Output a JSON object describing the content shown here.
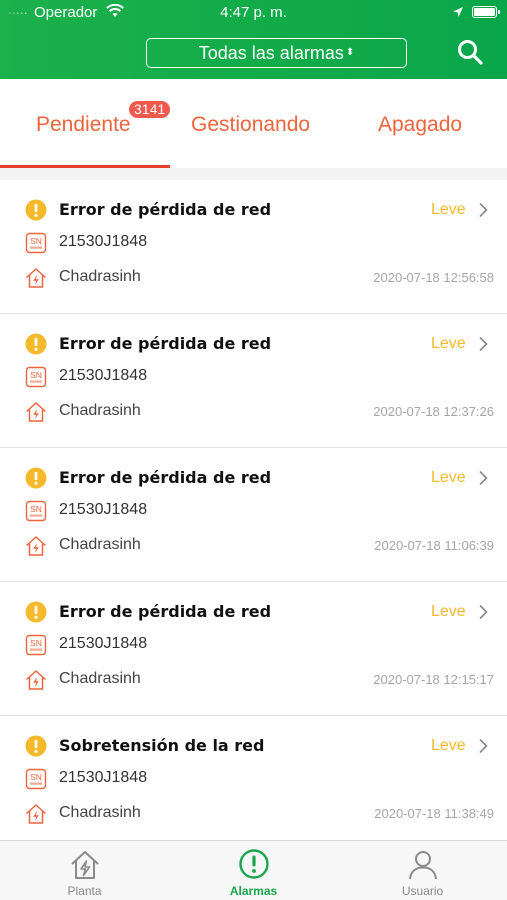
{
  "status_bar": {
    "signal": ".....",
    "carrier": "Operador",
    "time": "4:47 p. m."
  },
  "header": {
    "filter_label": "Todas las alarmas",
    "filter_arrows": "⬍",
    "search_icon": "search-icon"
  },
  "tabs": {
    "items": [
      {
        "label": "Pendiente",
        "badge": "3141",
        "active": true
      },
      {
        "label": "Gestionando",
        "active": false
      },
      {
        "label": "Apagado",
        "active": false
      }
    ]
  },
  "alarms": [
    {
      "title": "Error de pérdida de red",
      "level": "Leve",
      "sn": "21530J1848",
      "plant": "Chadrasinh",
      "time": "2020-07-18 12:56:58"
    },
    {
      "title": "Error de pérdida de red",
      "level": "Leve",
      "sn": "21530J1848",
      "plant": "Chadrasinh",
      "time": "2020-07-18 12:37:26"
    },
    {
      "title": "Error de pérdida de red",
      "level": "Leve",
      "sn": "21530J1848",
      "plant": "Chadrasinh",
      "time": "2020-07-18 11:06:39"
    },
    {
      "title": "Error de pérdida de red",
      "level": "Leve",
      "sn": "21530J1848",
      "plant": "Chadrasinh",
      "time": "2020-07-18 12:15:17"
    },
    {
      "title": "Sobretensión de la red",
      "level": "Leve",
      "sn": "21530J1848",
      "plant": "Chadrasinh",
      "time": "2020-07-18 11:38:49"
    }
  ],
  "icons": {
    "warning": "warning-circle-icon",
    "sn": "sn-tag-icon",
    "plant": "plant-house-icon",
    "chevron": "chevron-right-icon"
  },
  "tabbar": {
    "items": [
      {
        "label": "Planta",
        "icon": "plant-house-icon",
        "active": false
      },
      {
        "label": "Alarmas",
        "icon": "alarm-icon",
        "active": true
      },
      {
        "label": "Usuario",
        "icon": "user-icon",
        "active": false
      }
    ]
  },
  "colors": {
    "header_green": "#1bb14b",
    "tab_orange": "#f0643c",
    "badge_red": "#ef5a4c",
    "level_yellow": "#f5b92b",
    "active_green": "#1aa64c"
  }
}
